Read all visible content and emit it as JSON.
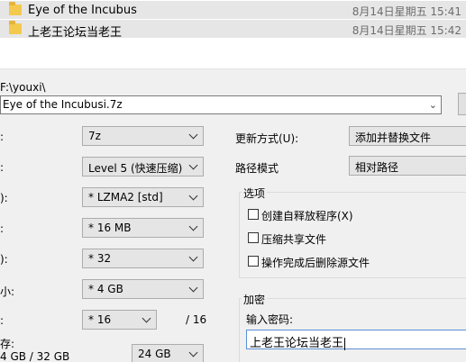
{
  "file_list": [
    {
      "name": "Eye of the Incubus",
      "date": "8月14日星期五 15:41"
    },
    {
      "name": "上老王论坛当老王",
      "date": "8月14日星期五 15:42"
    }
  ],
  "dialog": {
    "path": "F:\\youxi\\",
    "archive_name": "Eye of the Incubusi.7z",
    "left_labels": {
      "format": ":",
      "level": ":",
      "method": "):",
      "dict": ":",
      "word": "):",
      "solid": "小:",
      "threads": ":",
      "memory_line1": "存:",
      "memory_line2": "4 GB / 32 GB"
    },
    "archive_format": "7z",
    "compression_level": "Level 5 (快速压缩)",
    "compression_method": "* LZMA2 [std]",
    "dictionary_size": "* 16 MB",
    "word_size": "* 32",
    "solid_block_size": "* 4 GB",
    "threads": "* 16",
    "threads_total": "/ 16",
    "memory_limit": "24 GB",
    "update_mode_label": "更新方式(U):",
    "update_mode_value": "添加并替换文件",
    "path_mode_label": "路径模式",
    "path_mode_value": "相对路径",
    "options_title": "选项",
    "options": [
      "创建自释放程序(X)",
      "压缩共享文件",
      "操作完成后删除源文件"
    ],
    "encryption_title": "加密",
    "password_label": "输入密码:",
    "password_value": "上老王论坛当老王"
  }
}
